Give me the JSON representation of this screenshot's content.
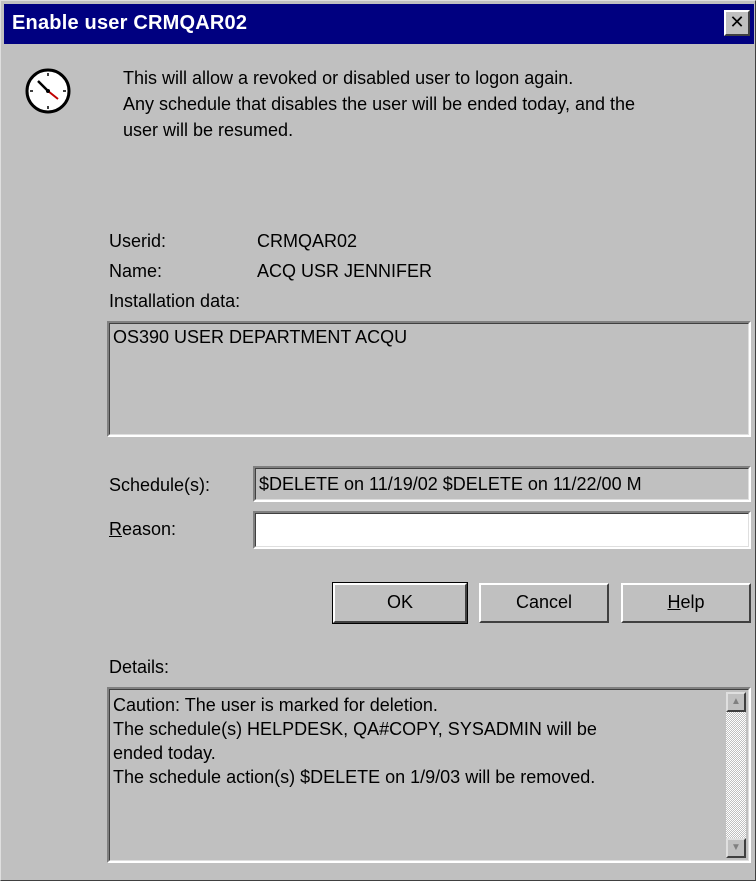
{
  "window": {
    "title": "Enable user CRMQAR02",
    "close_glyph": "✕"
  },
  "icon": "clock-icon",
  "message": [
    "This will allow a revoked or disabled user to logon again.",
    "Any schedule that disables the user will be ended today, and the",
    "user will be resumed."
  ],
  "user": {
    "userid_label": "Userid:",
    "userid": "CRMQAR02",
    "name_label": "Name:",
    "name": "ACQ USR JENNIFER",
    "installation_label": "Installation data:",
    "installation_data": "OS390 USER DEPARTMENT ACQU"
  },
  "schedules": {
    "label": "Schedule(s):",
    "value": "$DELETE on 11/19/02 $DELETE on 11/22/00 M"
  },
  "reason": {
    "label_mnemonic": "R",
    "label_rest": "eason:",
    "value": ""
  },
  "buttons": {
    "ok": "OK",
    "cancel": "Cancel",
    "help_mnemonic": "H",
    "help_rest": "elp"
  },
  "details": {
    "label": "Details:",
    "lines": [
      "Caution: The user is marked for deletion.",
      "The schedule(s) HELPDESK, QA#COPY, SYSADMIN will be",
      "ended today.",
      "The schedule action(s) $DELETE on 1/9/03 will be removed."
    ]
  }
}
